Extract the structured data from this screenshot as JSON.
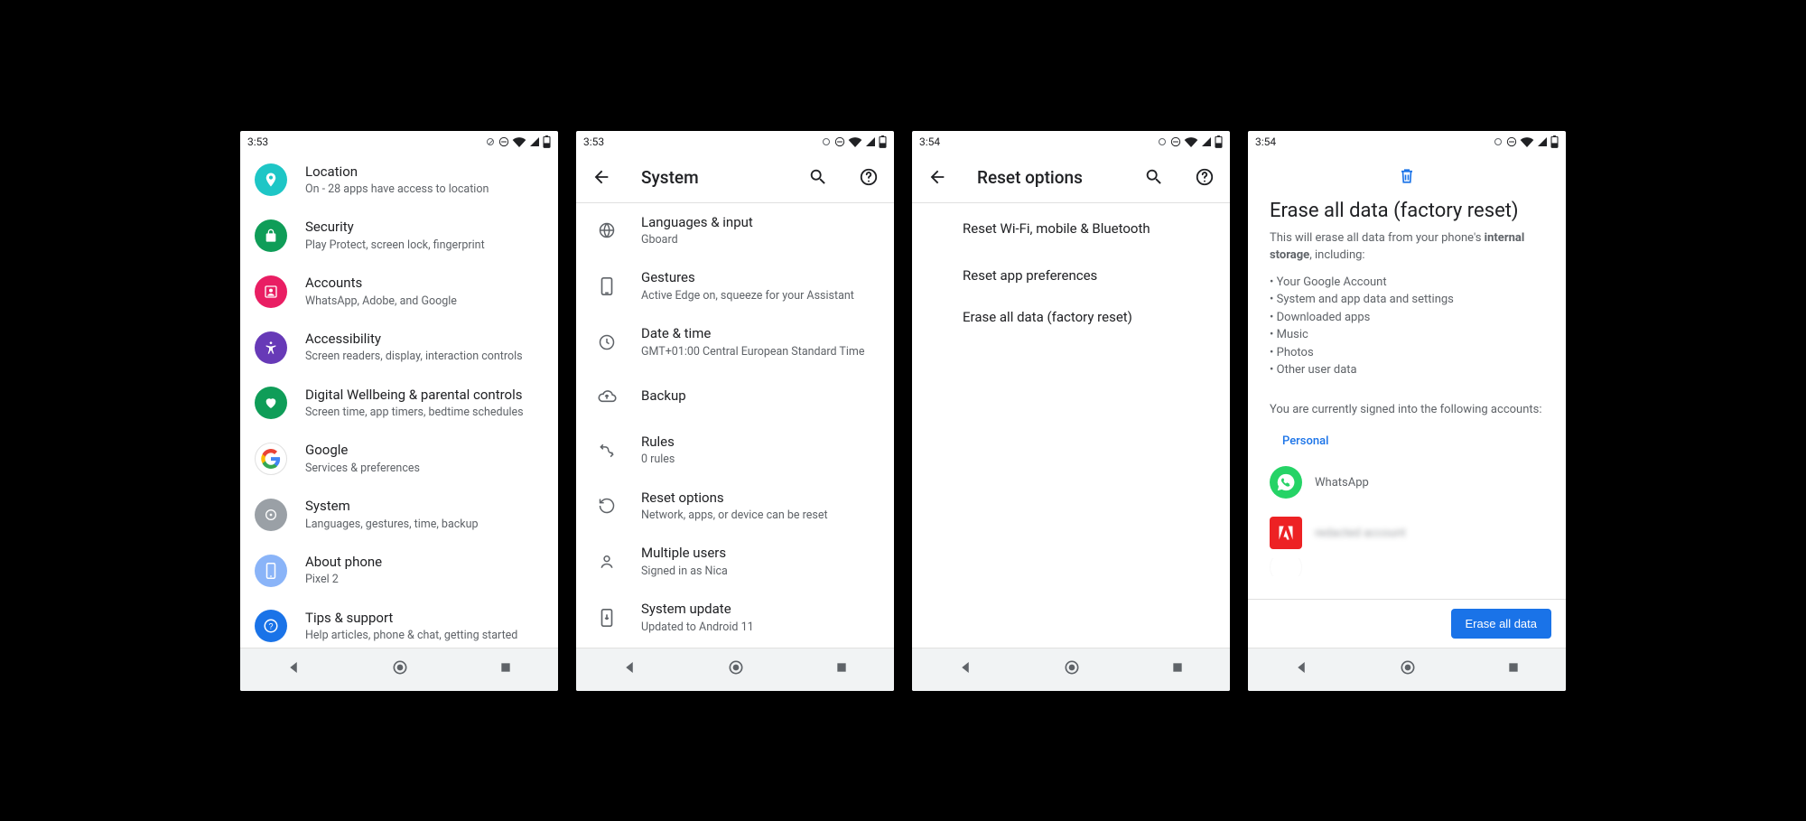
{
  "screens": {
    "s1": {
      "time": "3:53",
      "items": [
        {
          "title": "Location",
          "sub": "On - 28 apps have access to location"
        },
        {
          "title": "Security",
          "sub": "Play Protect, screen lock, fingerprint"
        },
        {
          "title": "Accounts",
          "sub": "WhatsApp, Adobe, and Google"
        },
        {
          "title": "Accessibility",
          "sub": "Screen readers, display, interaction controls"
        },
        {
          "title": "Digital Wellbeing & parental controls",
          "sub": "Screen time, app timers, bedtime schedules"
        },
        {
          "title": "Google",
          "sub": "Services & preferences"
        },
        {
          "title": "System",
          "sub": "Languages, gestures, time, backup"
        },
        {
          "title": "About phone",
          "sub": "Pixel 2"
        },
        {
          "title": "Tips & support",
          "sub": "Help articles, phone & chat, getting started"
        }
      ]
    },
    "s2": {
      "time": "3:53",
      "title": "System",
      "items": [
        {
          "title": "Languages & input",
          "sub": "Gboard"
        },
        {
          "title": "Gestures",
          "sub": "Active Edge on, squeeze for your Assistant"
        },
        {
          "title": "Date & time",
          "sub": "GMT+01:00 Central European Standard Time"
        },
        {
          "title": "Backup",
          "sub": ""
        },
        {
          "title": "Rules",
          "sub": "0 rules"
        },
        {
          "title": "Reset options",
          "sub": "Network, apps, or device can be reset"
        },
        {
          "title": "Multiple users",
          "sub": "Signed in as Nica"
        },
        {
          "title": "System update",
          "sub": "Updated to Android 11"
        }
      ]
    },
    "s3": {
      "time": "3:54",
      "title": "Reset options",
      "items": [
        {
          "title": "Reset Wi-Fi, mobile & Bluetooth"
        },
        {
          "title": "Reset app preferences"
        },
        {
          "title": "Erase all data (factory reset)"
        }
      ]
    },
    "s4": {
      "time": "3:54",
      "title": "Erase all data (factory reset)",
      "desc_a": "This will erase all data from your phone's ",
      "desc_b": "internal storage",
      "desc_c": ", including:",
      "bullets": [
        "Your Google Account",
        "System and app data and settings",
        "Downloaded apps",
        "Music",
        "Photos",
        "Other user data"
      ],
      "accounts_intro": "You are currently signed into the following accounts:",
      "personal_label": "Personal",
      "accounts": [
        {
          "name": "WhatsApp"
        },
        {
          "name": "redacted account"
        }
      ],
      "button": "Erase all data"
    }
  }
}
